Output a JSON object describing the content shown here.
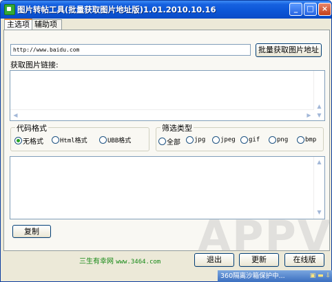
{
  "window": {
    "title": "图片转帖工具(批量获取图片地址版)1.01.2010.10.16",
    "min_glyph": "_",
    "max_glyph": "□",
    "close_glyph": "×"
  },
  "tabs": [
    {
      "label": "主选项",
      "selected": true
    },
    {
      "label": "辅助项",
      "selected": false
    }
  ],
  "url_input": {
    "value": "http://www.baidu.com"
  },
  "fetch_button": "批量获取图片地址",
  "links_label": "获取图片链接:",
  "scroll": {
    "up": "▲",
    "down": "▼",
    "left": "◀",
    "right": "▶"
  },
  "code_format": {
    "title": "代码格式",
    "options": [
      {
        "label": "无格式",
        "checked": true
      },
      {
        "label": "Html格式",
        "checked": false
      },
      {
        "label": "UBB格式",
        "checked": false
      }
    ]
  },
  "filter_type": {
    "title": "筛选类型",
    "options": [
      {
        "label": "全部",
        "checked": false
      },
      {
        "label": "jpg",
        "checked": false
      },
      {
        "label": "jpeg",
        "checked": false
      },
      {
        "label": "gif",
        "checked": false
      },
      {
        "label": "png",
        "checked": false
      },
      {
        "label": "bmp",
        "checked": false
      }
    ]
  },
  "copy_button": "复制",
  "footer": {
    "site_name": "三生有幸网",
    "site_url": "www.3464.com"
  },
  "buttons": {
    "exit": "退出",
    "update": "更新",
    "online": "在线版"
  },
  "watermark": "APPVN",
  "tray_tip": "360隔离沙箱保护中..."
}
